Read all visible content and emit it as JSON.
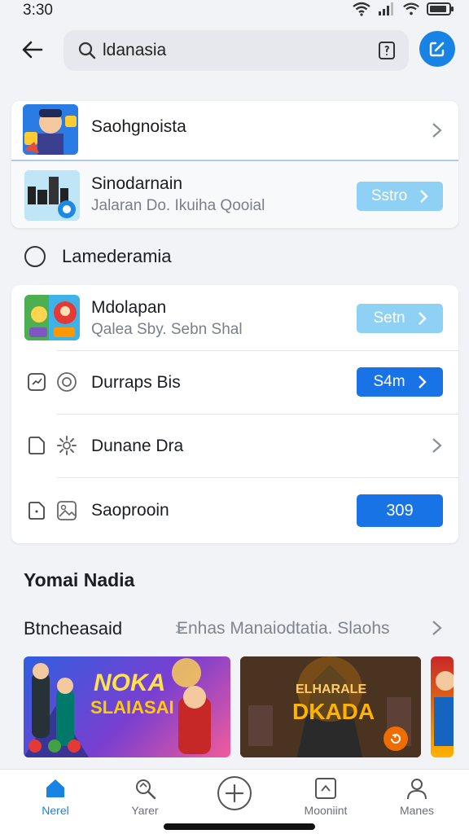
{
  "status_bar": {
    "time": "3:30"
  },
  "search": {
    "value": "ldanasia"
  },
  "featured": [
    {
      "title": "Saohgnoista"
    },
    {
      "title": "Sinodarnain",
      "subtitle": "Jalaran Do. Ikuiha Qooial",
      "button_label": "Sstro"
    }
  ],
  "section": {
    "label": "Lamederamia"
  },
  "list": [
    {
      "title": "Mdolapan",
      "subtitle": "Qalea Sby. Sebn Shal",
      "button_label": "Setn"
    },
    {
      "title": "Durraps Bis",
      "button_label": "S4m"
    },
    {
      "title": "Dunane Dra"
    },
    {
      "title": "Saoprooin",
      "button_label": "309"
    }
  ],
  "more": {
    "title": "Yomai Nadia",
    "breadcrumb_main": "Btncheasaid",
    "breadcrumb_sep": ">",
    "breadcrumb_sub": "Enhas Manaiodtatia. Slaohs"
  },
  "banners": [
    {
      "line1": "NOKA",
      "line2": "SLAIASAI"
    },
    {
      "line1": "ELHARALE",
      "line2": "DKADA"
    }
  ],
  "nav": [
    {
      "label": "Nerel",
      "icon": "home-icon",
      "active": true
    },
    {
      "label": "Yarer",
      "icon": "explore-icon",
      "active": false
    },
    {
      "label": "",
      "icon": "plus-circle-icon",
      "active": false
    },
    {
      "label": "Mooniint",
      "icon": "photo-frame-icon",
      "active": false
    },
    {
      "label": "Manes",
      "icon": "user-icon",
      "active": false
    }
  ],
  "colors": {
    "accent": "#1783e5",
    "button_dark": "#1873e6",
    "button_light": "#8fd0f5",
    "background": "#f1f3f7"
  }
}
